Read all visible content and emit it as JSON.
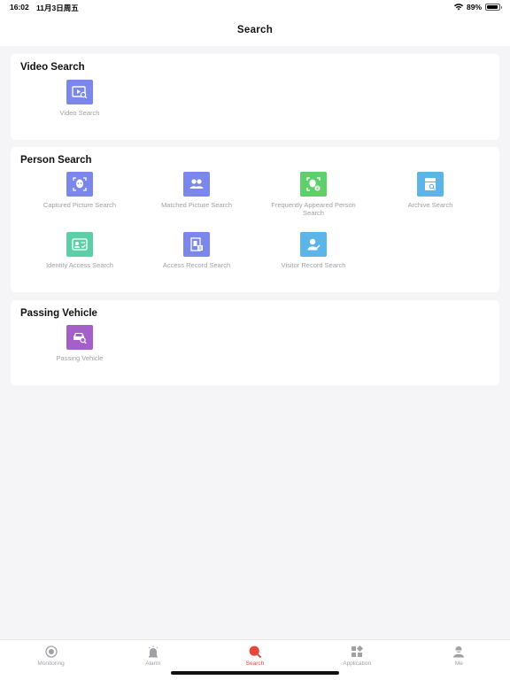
{
  "status_bar": {
    "time": "16:02",
    "date": "11月3日周五",
    "battery": "89%",
    "battery_level": 0.89
  },
  "header": {
    "title": "Search"
  },
  "sections": [
    {
      "title": "Video Search",
      "items": [
        {
          "label": "Video Search",
          "icon": "video-search-icon",
          "color": "#7b87ea"
        }
      ]
    },
    {
      "title": "Person Search",
      "items": [
        {
          "label": "Captured Picture Search",
          "icon": "face-capture-icon",
          "color": "#7b87ea"
        },
        {
          "label": "Matched Picture Search",
          "icon": "people-icon",
          "color": "#7b87ea"
        },
        {
          "label": "Frequently Appeared Person Search",
          "icon": "frequent-person-icon",
          "color": "#5fcf6b"
        },
        {
          "label": "Archive Search",
          "icon": "archive-search-icon",
          "color": "#5bb5e8"
        },
        {
          "label": "Identity Access Search",
          "icon": "id-card-icon",
          "color": "#5ccfa8"
        },
        {
          "label": "Access Record Search",
          "icon": "access-record-icon",
          "color": "#7b87ea"
        },
        {
          "label": "Visitor Record Search",
          "icon": "visitor-icon",
          "color": "#5bb5e8"
        }
      ]
    },
    {
      "title": "Passing Vehicle",
      "items": [
        {
          "label": "Passing Vehicle",
          "icon": "vehicle-search-icon",
          "color": "#a45fc8"
        }
      ]
    }
  ],
  "tabs": [
    {
      "label": "Monitoring",
      "icon": "monitoring-icon",
      "active": false
    },
    {
      "label": "Alarm",
      "icon": "alarm-icon",
      "active": false
    },
    {
      "label": "Search",
      "icon": "search-icon",
      "active": true
    },
    {
      "label": "Application",
      "icon": "application-icon",
      "active": false
    },
    {
      "label": "Me",
      "icon": "me-icon",
      "active": false
    }
  ],
  "colors": {
    "accent": "#e8453c",
    "inactive": "#a0a0a6"
  }
}
